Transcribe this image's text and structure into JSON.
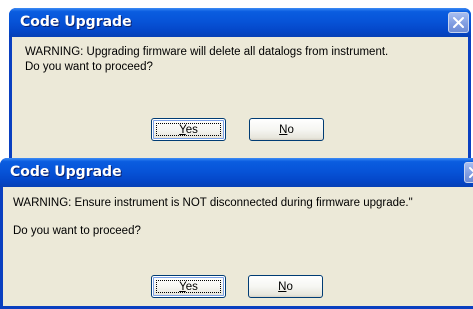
{
  "dialogs": [
    {
      "title": "Code Upgrade",
      "message_line1": "WARNING: Upgrading firmware will delete all datalogs from instrument.",
      "message_line2": "Do you want to proceed?",
      "yes_accel": "Y",
      "yes_rest": "es",
      "no_accel": "N",
      "no_rest": "o"
    },
    {
      "title": "Code Upgrade",
      "message_line1": "WARNING: Ensure instrument is NOT disconnected during firmware upgrade.\"",
      "message_line2": "Do you want to proceed?",
      "yes_accel": "Y",
      "yes_rest": "es",
      "no_accel": "N",
      "no_rest": "o"
    }
  ],
  "colors": {
    "title_bar": "#0754d8",
    "frame": "#0a3fc0",
    "client_bg": "#ece9d8",
    "button_border": "#003c74"
  },
  "icons": {
    "close": "close-icon"
  }
}
